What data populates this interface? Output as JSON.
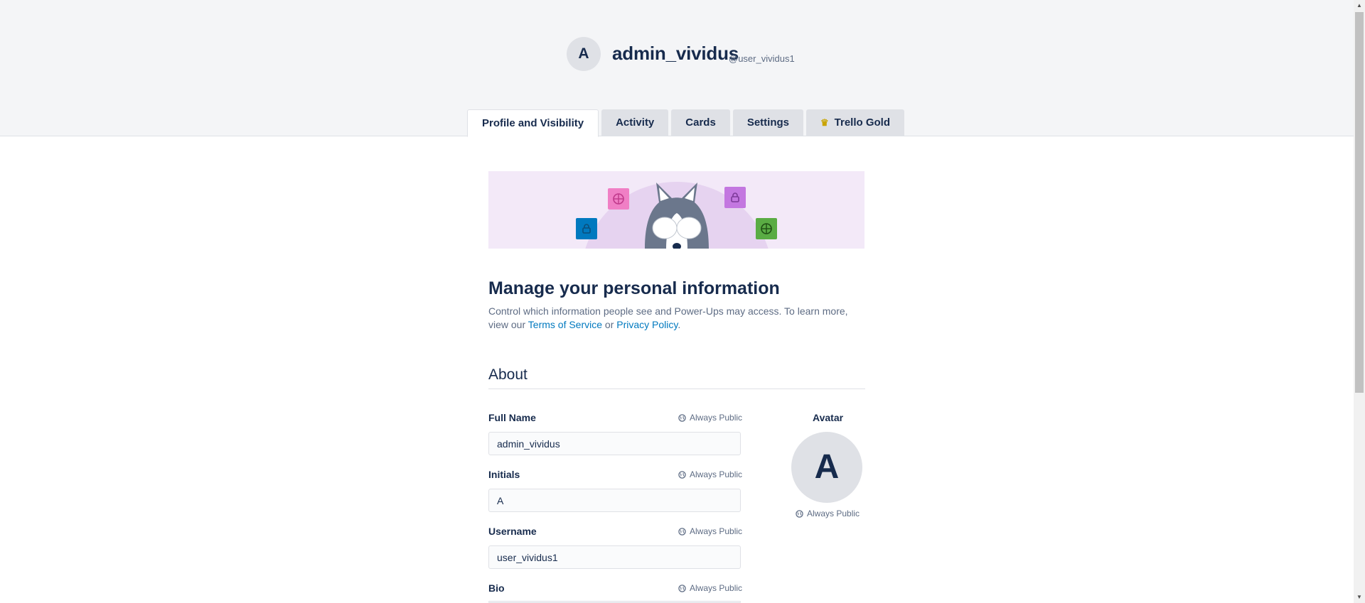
{
  "header": {
    "avatar_initial": "A",
    "display_name": "admin_vividus",
    "handle": "@user_vividus1"
  },
  "tabs": [
    {
      "label": "Profile and Visibility",
      "active": true
    },
    {
      "label": "Activity",
      "active": false
    },
    {
      "label": "Cards",
      "active": false
    },
    {
      "label": "Settings",
      "active": false
    },
    {
      "label": "Trello Gold",
      "active": false,
      "icon": "crown-icon"
    }
  ],
  "main": {
    "title": "Manage your personal information",
    "description_prefix": "Control which information people see and Power-Ups may access. To learn more, view our",
    "terms_link": "Terms of Service",
    "or_text": "or",
    "privacy_link": "Privacy Policy",
    "period": "."
  },
  "about": {
    "section_title": "About",
    "public_label": "Always Public",
    "fields": {
      "full_name": {
        "label": "Full Name",
        "value": "admin_vividus"
      },
      "initials": {
        "label": "Initials",
        "value": "A"
      },
      "username": {
        "label": "Username",
        "value": "user_vividus1"
      },
      "bio": {
        "label": "Bio"
      }
    },
    "avatar": {
      "label": "Avatar",
      "initial": "A"
    }
  },
  "colors": {
    "header_bg": "#f4f5f7",
    "text_primary": "#172b4d",
    "text_secondary": "#5e6c84",
    "link": "#0079bf",
    "banner_bg": "#f3e9f8"
  }
}
